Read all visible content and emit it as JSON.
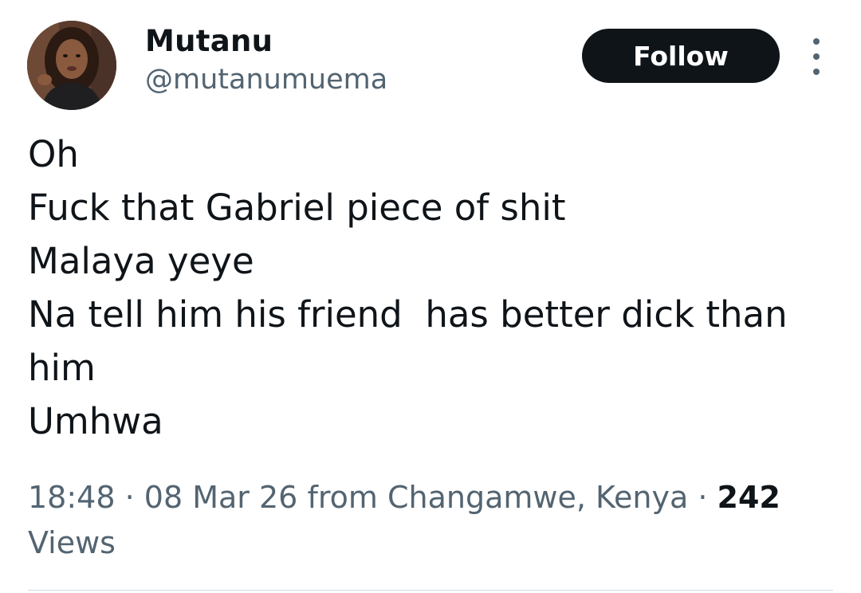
{
  "author": {
    "display_name": "Mutanu",
    "handle": "@mutanumuema"
  },
  "header": {
    "follow_label": "Follow"
  },
  "tweet": {
    "lines": [
      "Oh",
      "Fuck that Gabriel piece of shit",
      "Malaya yeye",
      "Na tell him his friend  has better dick than",
      "him",
      "Umhwa"
    ]
  },
  "meta": {
    "time": "18:48",
    "separator": "·",
    "date": "08 Mar 26",
    "location": "from Changamwe, Kenya",
    "views_count": "242",
    "views_label": "Views"
  },
  "icons": {
    "more": "more-vertical-icon",
    "avatar": "profile-photo"
  },
  "colors": {
    "text_primary": "#0f1419",
    "text_secondary": "#536471",
    "follow_bg": "#0f1419",
    "follow_text": "#ffffff",
    "divider": "#cfd9de"
  }
}
